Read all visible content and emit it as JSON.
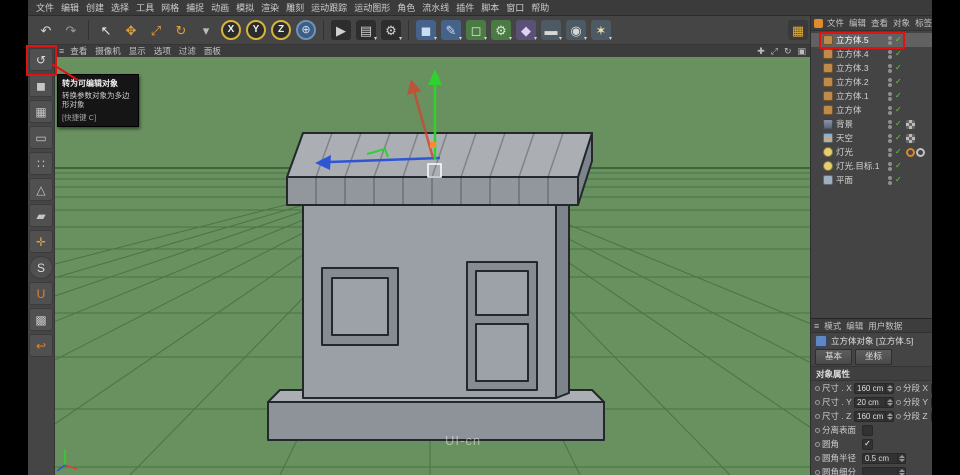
{
  "scene": {
    "colors": {
      "ground": "#68915f",
      "grid": "#41693c",
      "horizon": "#33572e",
      "outline": "#24272c",
      "top": "#abafb4",
      "front": "#9aa0a6",
      "side": "#7e848b",
      "roof": "#92979d",
      "base": "#8e9399",
      "frame": "#878c92",
      "pane": "#9da2a8",
      "axisx": "#cf4632",
      "axisy": "#2fd12f",
      "axisz": "#2f55d6",
      "accent2": "#ff8a2e",
      "annot": "#e01212"
    }
  },
  "menu_bar": {
    "items": [
      "文件",
      "编辑",
      "创建",
      "选择",
      "工具",
      "网格",
      "捕捉",
      "动画",
      "模拟",
      "渲染",
      "雕刻",
      "运动跟踪",
      "运动图形",
      "角色",
      "流水线",
      "插件",
      "脚本",
      "窗口",
      "帮助"
    ]
  },
  "toolbar": {
    "groups": [
      {
        "icons": [
          {
            "name": "undo-icon",
            "glyph": "↶",
            "fg": "#d9d9d9"
          },
          {
            "name": "redo-icon",
            "glyph": "↷",
            "fg": "#9a9a9a"
          }
        ]
      },
      {
        "icons": [
          {
            "name": "live-selection-icon",
            "glyph": "↖",
            "fg": "#e8e8e8"
          },
          {
            "name": "move-tool-icon",
            "glyph": "✥",
            "fg": "#e2a23c"
          },
          {
            "name": "scale-tool-icon",
            "glyph": "⤢",
            "fg": "#e2a23c"
          },
          {
            "name": "rotate-tool-icon",
            "glyph": "↻",
            "fg": "#e2a23c"
          },
          {
            "name": "last-tool-icon",
            "glyph": "▾",
            "fg": "#bdbdbd"
          },
          {
            "name": "lock-x-axis-icon",
            "glyph": "X",
            "fg": "#f0f0f0",
            "shape": "circle"
          },
          {
            "name": "lock-y-axis-icon",
            "glyph": "Y",
            "fg": "#f0f0f0",
            "shape": "circle"
          },
          {
            "name": "lock-z-axis-icon",
            "glyph": "Z",
            "fg": "#f0f0f0",
            "shape": "circle"
          },
          {
            "name": "coordinate-system-icon",
            "glyph": "⊕",
            "fg": "#cfe2f5",
            "bg": "#3c5e83",
            "shape": "round"
          }
        ]
      },
      {
        "icons": [
          {
            "name": "render-view-icon",
            "glyph": "▶",
            "fg": "#d0d0d0",
            "bg": "#2d2d2d"
          },
          {
            "name": "render-picture-viewer-icon",
            "glyph": "▤",
            "fg": "#d0d0d0",
            "bg": "#2d2d2d",
            "caret": "▾"
          },
          {
            "name": "render-settings-icon",
            "glyph": "⚙",
            "fg": "#d0d0d0",
            "bg": "#2d2d2d",
            "caret": "▾"
          }
        ]
      },
      {
        "icons": [
          {
            "name": "add-primitive-cube-icon",
            "glyph": "◼",
            "fg": "#c9dcf2",
            "bg": "#45628a",
            "caret": "▾"
          },
          {
            "name": "add-spline-icon",
            "glyph": "✎",
            "fg": "#c9dcf2",
            "bg": "#45628a",
            "caret": "▾"
          },
          {
            "name": "add-subdivision-icon",
            "glyph": "◻",
            "fg": "#d2e8cd",
            "bg": "#4c7a45",
            "caret": "▾"
          },
          {
            "name": "add-generator-icon",
            "glyph": "⚙",
            "fg": "#d2e8cd",
            "bg": "#4c7a45",
            "caret": "▾"
          },
          {
            "name": "add-deformer-icon",
            "glyph": "◆",
            "fg": "#ded2f0",
            "bg": "#5b5177",
            "caret": "▾"
          },
          {
            "name": "add-environment-icon",
            "glyph": "▬",
            "fg": "#d6d6d6",
            "bg": "#4d5a64",
            "caret": "▾"
          },
          {
            "name": "add-camera-icon",
            "glyph": "◉",
            "fg": "#d6d6d6",
            "bg": "#4d5a64",
            "caret": "▾"
          },
          {
            "name": "add-light-icon",
            "glyph": "✶",
            "fg": "#f2e3ac",
            "bg": "#4d5a64",
            "caret": "▾"
          }
        ]
      },
      {
        "icons": [
          {
            "name": "layout-icon",
            "glyph": "▦",
            "fg": "#e0b13c",
            "bg": "#3a3a3a"
          }
        ]
      }
    ]
  },
  "left_toolbar": {
    "icons": [
      {
        "name": "make-editable-icon",
        "glyph": "↺",
        "fg": "#dcdcdc"
      },
      {
        "name": "model-mode-icon",
        "glyph": "◼",
        "fg": "#c6c6c6"
      },
      {
        "name": "texture-mode-icon",
        "glyph": "▦",
        "fg": "#c6c6c6"
      },
      {
        "name": "workplane-mode-icon",
        "glyph": "▭",
        "fg": "#c6c6c6"
      },
      {
        "name": "points-mode-icon",
        "glyph": "∷",
        "fg": "#c6c6c6"
      },
      {
        "name": "edges-mode-icon",
        "glyph": "△",
        "fg": "#c6c6c6"
      },
      {
        "name": "polygons-mode-icon",
        "glyph": "▰",
        "fg": "#c6c6c6"
      },
      {
        "name": "enable-axis-icon",
        "glyph": "✛",
        "fg": "#e2a23c"
      },
      {
        "name": "snap-icon",
        "glyph": "S",
        "fg": "#dcdcdc",
        "shape": "circle"
      },
      {
        "name": "magnet-icon",
        "glyph": "U",
        "fg": "#e2832c"
      },
      {
        "name": "quantize-icon",
        "glyph": "▩",
        "fg": "#c6c6c6"
      },
      {
        "name": "lock-workplane-icon",
        "glyph": "↩",
        "fg": "#e2832c"
      }
    ]
  },
  "viewport": {
    "menu_icon": "≡",
    "menu_items": [
      "查看",
      "摄像机",
      "显示",
      "选项",
      "过滤",
      "面板"
    ],
    "controls": [
      {
        "name": "pan-view-icon",
        "glyph": "✚"
      },
      {
        "name": "zoom-view-icon",
        "glyph": "⤢"
      },
      {
        "name": "rotate-view-icon",
        "glyph": "↻"
      },
      {
        "name": "maximize-view-icon",
        "glyph": "▣"
      }
    ],
    "watermark": "UI-cn"
  },
  "tooltip": {
    "line1": "转为可编辑对象",
    "line2": "转换参数对象为多边形对象",
    "line3": "[快捷键 C]"
  },
  "object_manager": {
    "menu": [
      "文件",
      "编辑",
      "查看",
      "对象",
      "标签"
    ],
    "items": [
      {
        "label": "立方体.5",
        "icon": "cube",
        "selected": true,
        "check": "✓"
      },
      {
        "label": "立方体.4",
        "icon": "cube",
        "check": "✓"
      },
      {
        "label": "立方体.3",
        "icon": "cube",
        "check": "✓"
      },
      {
        "label": "立方体.2",
        "icon": "cube",
        "check": "✓"
      },
      {
        "label": "立方体.1",
        "icon": "cube",
        "check": "✓"
      },
      {
        "label": "立方体",
        "icon": "cube",
        "check": "✓"
      },
      {
        "label": "背景",
        "icon": "background",
        "check": "✓",
        "tag_a": "checker"
      },
      {
        "label": "天空",
        "icon": "sky",
        "check": "✓",
        "tag_a": "checker"
      },
      {
        "label": "灯光",
        "icon": "light",
        "check": "✓",
        "tag_a": "target",
        "tag_b": "ring"
      },
      {
        "label": "灯光.目标.1",
        "icon": "light",
        "check": "✓"
      },
      {
        "label": "平面",
        "icon": "plane",
        "check": "✓"
      }
    ]
  },
  "attribute_panel": {
    "menu_icon": "≡",
    "mode_menu": [
      "模式",
      "编辑",
      "用户数据"
    ],
    "object_title": "立方体对象 [立方体.5]",
    "tab_buttons": [
      "基本",
      "坐标"
    ],
    "section_title": "对象属性",
    "dimension_rows": [
      {
        "label": "尺寸 . X",
        "value": "160 cm",
        "seg_label": "分段 X"
      },
      {
        "label": "尺寸 . Y",
        "value": "20 cm",
        "seg_label": "分段 Y"
      },
      {
        "label": "尺寸 . Z",
        "value": "160 cm",
        "seg_label": "分段 Z"
      }
    ],
    "separate_surfaces": {
      "label": "分离表面",
      "check_glyph": ""
    },
    "fillet": {
      "label": "圆角",
      "check_glyph": "✓"
    },
    "fillet_radius": {
      "label": "圆角半径",
      "value": "0.5 cm"
    },
    "fillet_subdivision": {
      "label": "圆角细分",
      "value": ""
    }
  }
}
